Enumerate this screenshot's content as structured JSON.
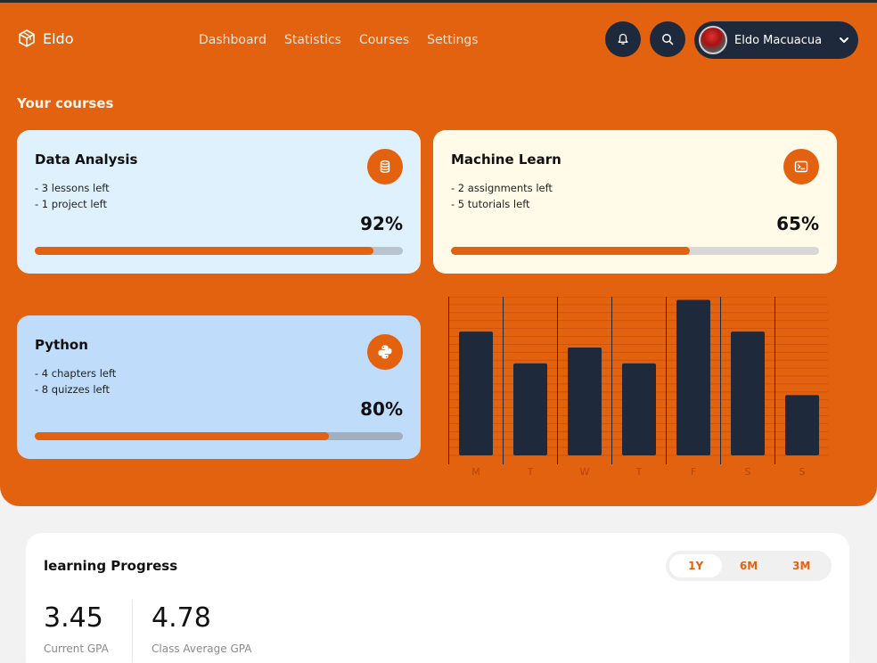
{
  "brand": {
    "name": "Eldo"
  },
  "nav": [
    "Dashboard",
    "Statistics",
    "Courses",
    "Settings"
  ],
  "user": {
    "name": "Eldo Macuacua"
  },
  "section_title": "Your courses",
  "courses": [
    {
      "title": "Data Analysis",
      "lines": [
        "- 3 lessons left",
        "- 1 project left"
      ],
      "percent_label": "92%",
      "progress": 0.92,
      "bg": "#dff1fd",
      "track": "#b7c3cf",
      "icon": "database-icon"
    },
    {
      "title": "Machine Learn",
      "lines": [
        "- 2 assignments left",
        "- 5 tutorials left"
      ],
      "percent_label": "65%",
      "progress": 0.65,
      "bg": "#fffbe8",
      "track": "#d8d8d8",
      "icon": "terminal-icon"
    },
    {
      "title": "Python",
      "lines": [
        "- 4 chapters left",
        "- 8 quizzes left"
      ],
      "percent_label": "80%",
      "progress": 0.8,
      "bg": "#bfdcfb",
      "track": "#a1afbf",
      "icon": "python-icon"
    }
  ],
  "chart_data": {
    "type": "bar",
    "categories": [
      "M",
      "T",
      "W",
      "T",
      "F",
      "S",
      "S"
    ],
    "values": [
      7.8,
      5.8,
      6.8,
      5.8,
      9.8,
      7.8,
      3.8
    ],
    "ylim": [
      0,
      10
    ],
    "grid": true,
    "bar_color": "#1e2a3b",
    "grid_color": "#c94f08"
  },
  "progress_panel": {
    "title": "learning Progress",
    "ranges": [
      "1Y",
      "6M",
      "3M"
    ],
    "active_range": "1Y",
    "current_gpa": {
      "value": "3.45",
      "label": "Current GPA"
    },
    "class_gpa": {
      "value": "4.78",
      "label": "Class Average GPA"
    }
  },
  "colors": {
    "accent": "#e3620f",
    "dark": "#1e2a3b"
  }
}
